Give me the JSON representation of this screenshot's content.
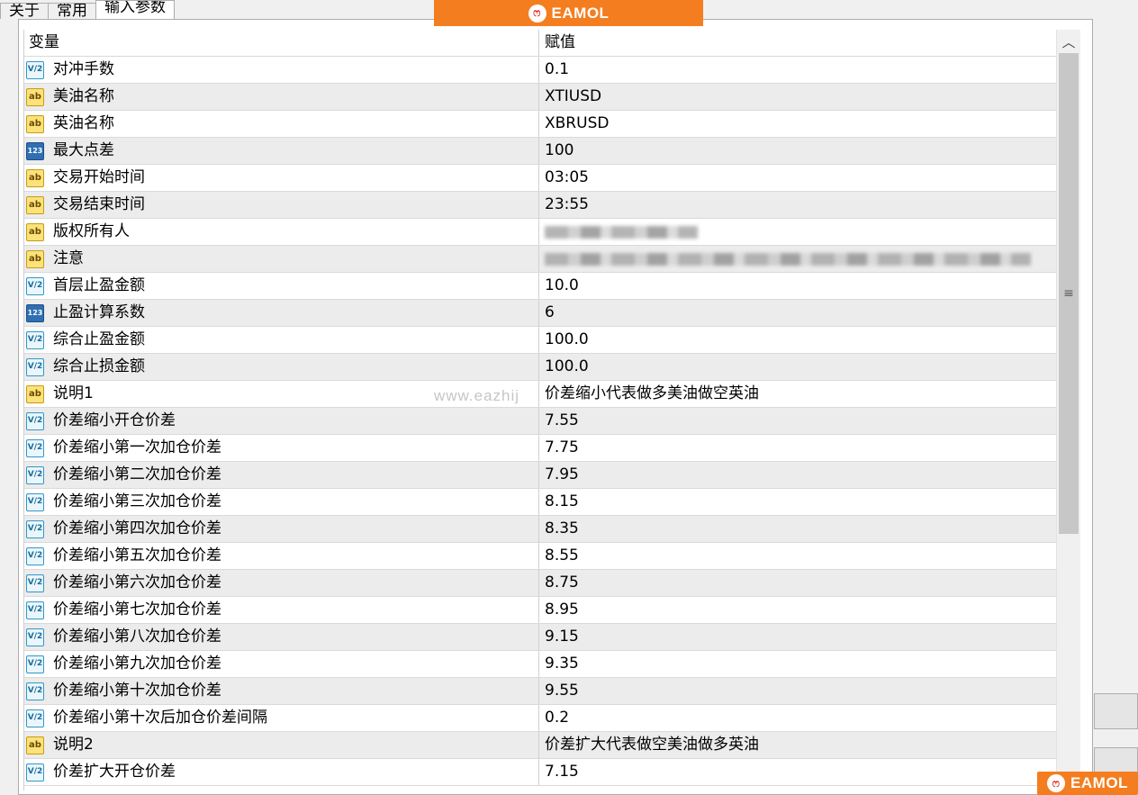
{
  "tabs": [
    {
      "label": "关于"
    },
    {
      "label": "常用"
    },
    {
      "label": "输入参数"
    }
  ],
  "brand": {
    "logo_text": "EAMOL",
    "logo_mark": "ෆ"
  },
  "watermark": "www.eazhij",
  "grid": {
    "header": {
      "name": "变量",
      "value": "赋值"
    },
    "rows": [
      {
        "icon": "v12",
        "name": "对冲手数",
        "value": "0.1"
      },
      {
        "icon": "ab",
        "name": "美油名称",
        "value": "XTIUSD"
      },
      {
        "icon": "ab",
        "name": "英油名称",
        "value": "XBRUSD"
      },
      {
        "icon": "n123",
        "name": "最大点差",
        "value": "100"
      },
      {
        "icon": "ab",
        "name": "交易开始时间",
        "value": "03:05"
      },
      {
        "icon": "ab",
        "name": "交易结束时间",
        "value": "23:55"
      },
      {
        "icon": "ab",
        "name": "版权所有人",
        "value": "",
        "redacted": true
      },
      {
        "icon": "ab",
        "name": "注意",
        "value": "",
        "redacted": true
      },
      {
        "icon": "v12",
        "name": "首层止盈金额",
        "value": "10.0"
      },
      {
        "icon": "n123",
        "name": "止盈计算系数",
        "value": "6"
      },
      {
        "icon": "v12",
        "name": "综合止盈金额",
        "value": "100.0"
      },
      {
        "icon": "v12",
        "name": "综合止损金额",
        "value": "100.0"
      },
      {
        "icon": "ab",
        "name": "说明1",
        "value": "价差缩小代表做多美油做空英油"
      },
      {
        "icon": "v12",
        "name": "价差缩小开仓价差",
        "value": "7.55"
      },
      {
        "icon": "v12",
        "name": "价差缩小第一次加仓价差",
        "value": "7.75"
      },
      {
        "icon": "v12",
        "name": "价差缩小第二次加仓价差",
        "value": "7.95"
      },
      {
        "icon": "v12",
        "name": "价差缩小第三次加仓价差",
        "value": "8.15"
      },
      {
        "icon": "v12",
        "name": "价差缩小第四次加仓价差",
        "value": "8.35"
      },
      {
        "icon": "v12",
        "name": "价差缩小第五次加仓价差",
        "value": "8.55"
      },
      {
        "icon": "v12",
        "name": "价差缩小第六次加仓价差",
        "value": "8.75"
      },
      {
        "icon": "v12",
        "name": "价差缩小第七次加仓价差",
        "value": "8.95"
      },
      {
        "icon": "v12",
        "name": "价差缩小第八次加仓价差",
        "value": "9.15"
      },
      {
        "icon": "v12",
        "name": "价差缩小第九次加仓价差",
        "value": "9.35"
      },
      {
        "icon": "v12",
        "name": "价差缩小第十次加仓价差",
        "value": "9.55"
      },
      {
        "icon": "v12",
        "name": "价差缩小第十次后加仓价差间隔",
        "value": "0.2"
      },
      {
        "icon": "ab",
        "name": "说明2",
        "value": "价差扩大代表做空美油做多英油"
      },
      {
        "icon": "v12",
        "name": "价差扩大开仓价差",
        "value": "7.15"
      }
    ]
  },
  "icons": {
    "v12": "V/2",
    "ab": "ab",
    "n123": "123"
  },
  "scrollbar": {
    "up_glyph": "︿",
    "grip_glyph": "≡",
    "position": 0.0
  },
  "colors": {
    "brand_orange": "#f47d1f",
    "row_shade": "#ececec",
    "panel_bg": "#ffffff",
    "window_bg": "#f0f0f0"
  }
}
